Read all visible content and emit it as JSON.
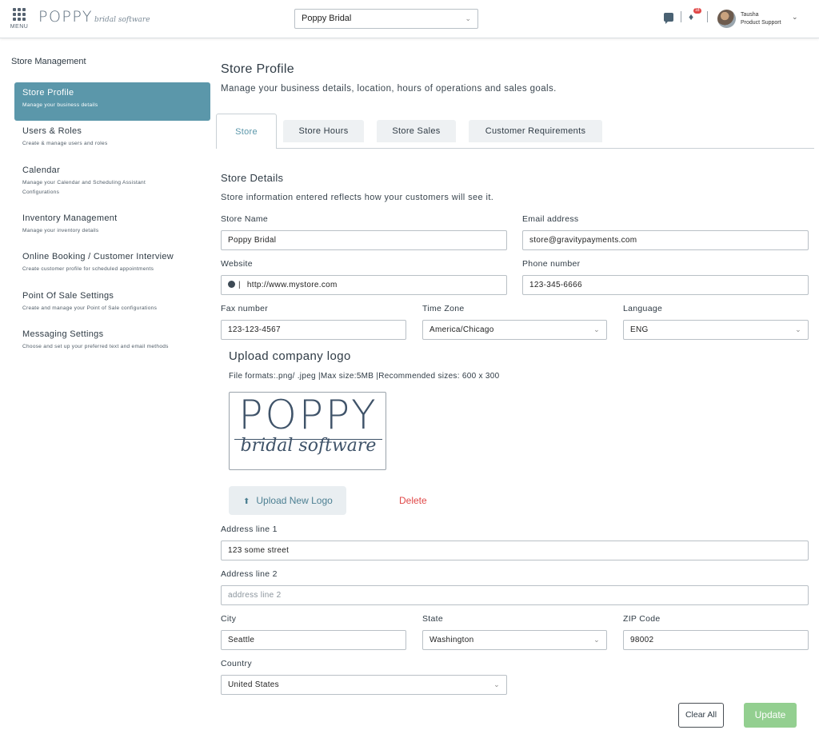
{
  "header": {
    "menu_label": "MENU",
    "brand_name": "POPPY",
    "brand_sub": "bridal software",
    "store_select": "Poppy Bridal",
    "notification_count": "18",
    "user_name": "Tausha",
    "user_role": "Product Support"
  },
  "sidebar": {
    "title": "Store Management",
    "items": [
      {
        "label": "Store Profile",
        "desc": "Manage your business details"
      },
      {
        "label": "Users & Roles",
        "desc": "Create & manage users and roles"
      },
      {
        "label": "Calendar",
        "desc": "Manage your Calendar and Scheduling Assistant Configurations"
      },
      {
        "label": "Inventory Management",
        "desc": "Manage your inventory details"
      },
      {
        "label": "Online Booking / Customer Interview",
        "desc": "Create customer profile for scheduled appointments"
      },
      {
        "label": "Point Of Sale Settings",
        "desc": "Create and manage your Point of Sale configurations"
      },
      {
        "label": "Messaging Settings",
        "desc": "Choose and set up your preferred text and email methods"
      }
    ]
  },
  "main": {
    "title": "Store Profile",
    "subtitle": "Manage your business details, location, hours of operations and sales goals.",
    "tabs": [
      "Store",
      "Store Hours",
      "Store Sales",
      "Customer Requirements"
    ],
    "section_title": "Store Details",
    "section_sub": "Store information entered reflects how your customers will see it."
  },
  "form": {
    "store_name": {
      "label": "Store Name",
      "value": "Poppy Bridal"
    },
    "email": {
      "label": "Email address",
      "value": "store@gravitypayments.com"
    },
    "website": {
      "label": "Website",
      "value": "http://www.mystore.com"
    },
    "phone": {
      "label": "Phone number",
      "value": "123-345-6666"
    },
    "fax": {
      "label": "Fax number",
      "value": "123-123-4567"
    },
    "timezone": {
      "label": "Time Zone",
      "value": "America/Chicago"
    },
    "language": {
      "label": "Language",
      "value": "ENG"
    },
    "address1": {
      "label": "Address line 1",
      "value": "123 some street"
    },
    "address2": {
      "label": "Address line 2",
      "placeholder": "address line 2"
    },
    "city": {
      "label": "City",
      "value": "Seattle"
    },
    "state": {
      "label": "State",
      "value": "Washington"
    },
    "zip": {
      "label": "ZIP Code",
      "value": "98002"
    },
    "country": {
      "label": "Country",
      "value": "United States"
    }
  },
  "logo": {
    "title": "Upload company logo",
    "formats": "File formats:.png/ .jpeg |Max size:5MB |Recommended sizes: 600 x 300",
    "big": "POPPY",
    "script": "bridal software",
    "upload_label": "Upload New Logo",
    "delete_label": "Delete"
  },
  "actions": {
    "clear": "Clear All",
    "update": "Update"
  },
  "colors": {
    "accent": "#5b97aa",
    "update_btn": "#93cf90",
    "delete": "#e04848"
  }
}
